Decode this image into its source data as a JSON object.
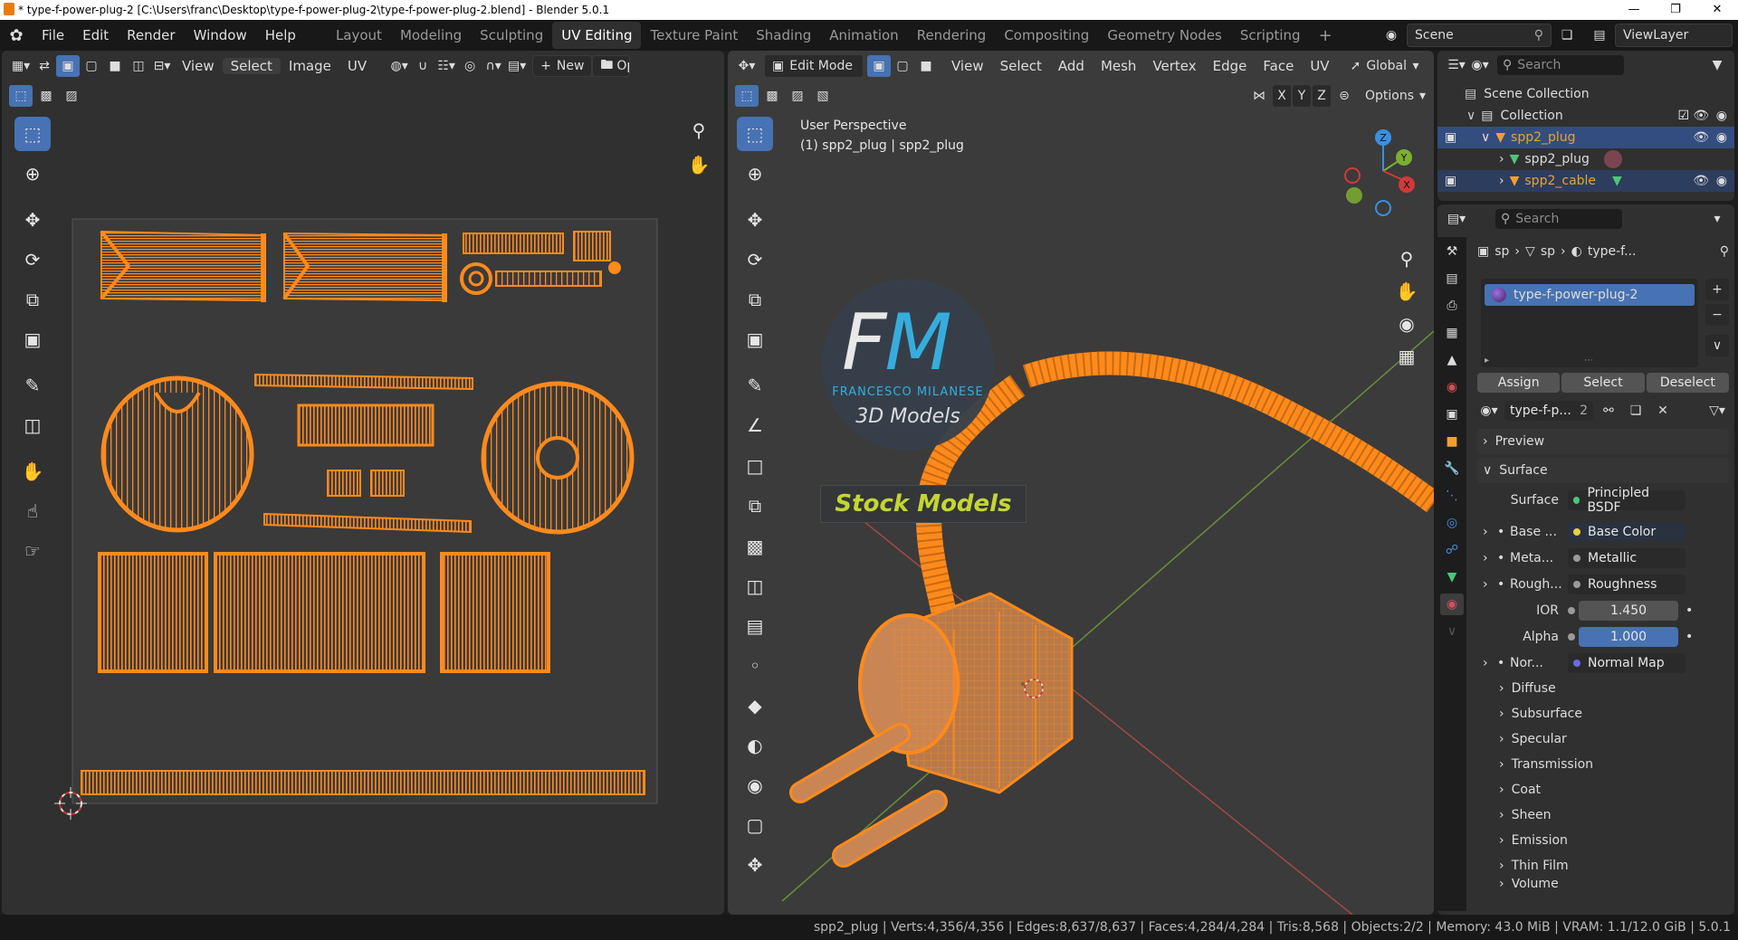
{
  "window": {
    "title": "* type-f-power-plug-2 [C:\\Users\\franc\\Desktop\\type-f-power-plug-2\\type-f-power-plug-2.blend] - Blender 5.0.1"
  },
  "menu": [
    "File",
    "Edit",
    "Render",
    "Window",
    "Help"
  ],
  "workspaces": [
    "Layout",
    "Modeling",
    "Sculpting",
    "UV Editing",
    "Texture Paint",
    "Shading",
    "Animation",
    "Rendering",
    "Compositing",
    "Geometry Nodes",
    "Scripting"
  ],
  "active_workspace": "UV Editing",
  "scene": "Scene",
  "view_layer": "ViewLayer",
  "uv_editor": {
    "menus": [
      "View",
      "Select",
      "Image",
      "UV"
    ],
    "new_label": "New",
    "open_label": "Op"
  },
  "viewport": {
    "mode": "Edit Mode",
    "menus": [
      "View",
      "Select",
      "Add",
      "Mesh",
      "Vertex",
      "Edge",
      "Face",
      "UV"
    ],
    "transform": "Global",
    "axes": [
      "X",
      "Y",
      "Z"
    ],
    "options": "Options",
    "overlay_line1": "User Perspective",
    "overlay_line2": "(1) spp2_plug | spp2_plug",
    "gizmo": {
      "x": "X",
      "y": "Y",
      "z": "Z"
    },
    "logo": {
      "letters": "FM",
      "name": "FRANCESCO MILANESE",
      "sub": "3D Models",
      "badge": "Stock Models"
    }
  },
  "outliner": {
    "search_placeholder": "Search",
    "items": [
      {
        "label": "Scene Collection"
      },
      {
        "label": "Collection"
      },
      {
        "label": "spp2_plug"
      },
      {
        "label": "spp2_plug"
      },
      {
        "label": "spp2_cable"
      }
    ]
  },
  "properties": {
    "search_placeholder": "Search",
    "breadcrumb": [
      "sp",
      "sp",
      "type-f..."
    ],
    "material_slot": "type-f-power-plug-2",
    "buttons": [
      "Assign",
      "Select",
      "Deselect"
    ],
    "material_name": "type-f-p...",
    "user_count": "2",
    "sections": {
      "preview": "Preview",
      "surface": "Surface"
    },
    "surface_label": "Surface",
    "surface_value": "Principled BSDF",
    "inputs": [
      {
        "label": "Base ...",
        "value": "Base Color"
      },
      {
        "label": "Meta...",
        "value": "Metallic"
      },
      {
        "label": "Rough...",
        "value": "Roughness"
      },
      {
        "label": "IOR",
        "value": "1.450"
      },
      {
        "label": "Alpha",
        "value": "1.000"
      },
      {
        "label": "Nor...",
        "value": "Normal Map"
      }
    ],
    "subsections": [
      "Diffuse",
      "Subsurface",
      "Specular",
      "Transmission",
      "Coat",
      "Sheen",
      "Emission",
      "Thin Film",
      "Volume"
    ]
  },
  "status": "spp2_plug | Verts:4,356/4,356 | Edges:8,637/8,637 | Faces:4,284/4,284 | Tris:8,568 | Objects:2/2 | Memory: 43.0 MiB | VRAM: 1.1/12.0 GiB | 5.0.1",
  "colors": {
    "accent": "#4772b3",
    "mesh_orange": "#ff8a1c",
    "object_orange": "#f0a030",
    "panel": "#303030",
    "bg": "#1d1d1d"
  }
}
